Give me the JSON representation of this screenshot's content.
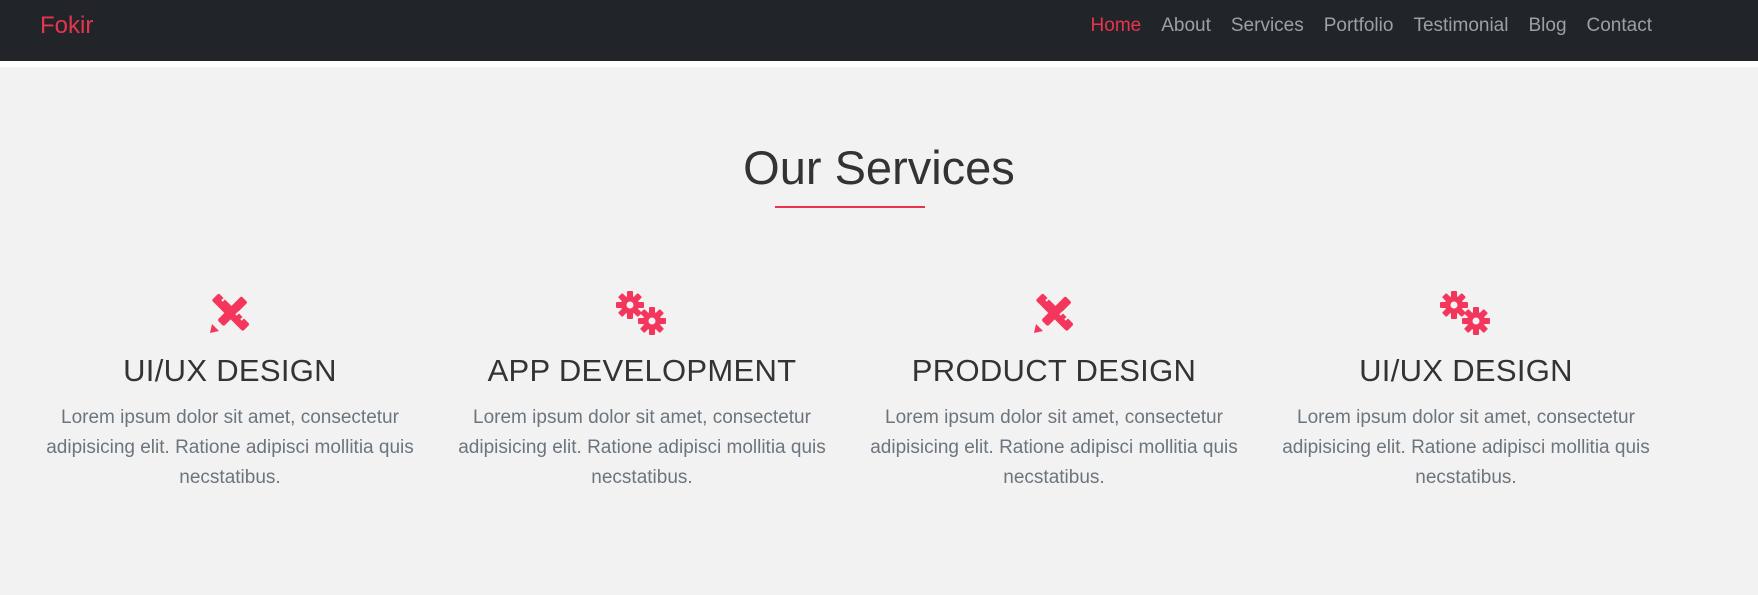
{
  "nav": {
    "brand": "Fokir",
    "links": [
      "Home",
      "About",
      "Services",
      "Portfolio",
      "Testimonial",
      "Blog",
      "Contact"
    ],
    "active_link": "Home"
  },
  "services_section": {
    "title": "Our Services",
    "cards": [
      {
        "icon": "pencil-ruler-icon",
        "title": "UI/UX DESIGN",
        "description": "Lorem ipsum dolor sit amet, consectetur adipisicing elit. Ratione adipisci mollitia quis necstatibus."
      },
      {
        "icon": "gears-icon",
        "title": "APP DEVELOPMENT",
        "description": "Lorem ipsum dolor sit amet, consectetur adipisicing elit. Ratione adipisci mollitia quis necstatibus."
      },
      {
        "icon": "pencil-ruler-icon",
        "title": "PRODUCT DESIGN",
        "description": "Lorem ipsum dolor sit amet, consectetur adipisicing elit. Ratione adipisci mollitia quis necstatibus."
      },
      {
        "icon": "gears-icon",
        "title": "UI/UX DESIGN",
        "description": "Lorem ipsum dolor sit amet, consectetur adipisicing elit. Ratione adipisci mollitia quis necstatibus."
      }
    ]
  },
  "colors": {
    "accent": "#e8344e",
    "navbar_bg": "#212529",
    "section_bg": "#f2f2f2",
    "heading": "#333333",
    "body_text": "#6c757d"
  }
}
